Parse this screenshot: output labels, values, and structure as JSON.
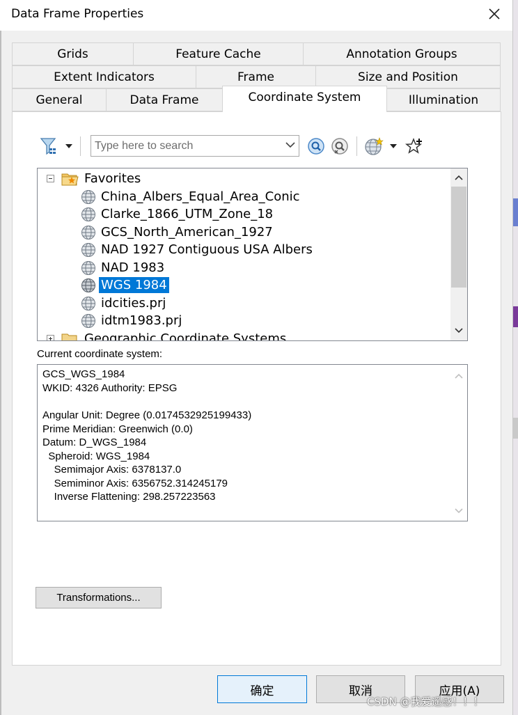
{
  "window": {
    "title": "Data Frame Properties"
  },
  "tabs": {
    "row1": [
      "Grids",
      "Feature Cache",
      "Annotation Groups"
    ],
    "row2": [
      "Extent Indicators",
      "Frame",
      "Size and Position"
    ],
    "row3": [
      "General",
      "Data Frame",
      "Coordinate System",
      "Illumination"
    ],
    "active": "Coordinate System"
  },
  "toolbar": {
    "search_placeholder": "Type here to search",
    "icons": [
      "filter-icon",
      "search-icon",
      "clear-search-icon",
      "globe-add-icon",
      "favorite-star-icon"
    ]
  },
  "tree": {
    "root_label": "Favorites",
    "items": [
      "China_Albers_Equal_Area_Conic",
      "Clarke_1866_UTM_Zone_18",
      "GCS_North_American_1927",
      "NAD 1927 Contiguous USA Albers",
      "NAD 1983",
      "WGS 1984",
      "idcities.prj",
      "idtm1983.prj"
    ],
    "selected": "WGS 1984",
    "next_folder": "Geographic Coordinate Systems"
  },
  "current": {
    "label": "Current coordinate system:",
    "lines": [
      "GCS_WGS_1984",
      "WKID: 4326 Authority: EPSG",
      "",
      "Angular Unit: Degree (0.0174532925199433)",
      "Prime Meridian: Greenwich (0.0)",
      "Datum: D_WGS_1984",
      "  Spheroid: WGS_1984",
      "    Semimajor Axis: 6378137.0",
      "    Semiminor Axis: 6356752.314245179",
      "    Inverse Flattening: 298.257223563"
    ]
  },
  "buttons": {
    "transformations": "Transformations...",
    "ok": "确定",
    "cancel": "取消",
    "apply": "应用(A)"
  },
  "watermark": "CSDN @我爱遥感！！！"
}
